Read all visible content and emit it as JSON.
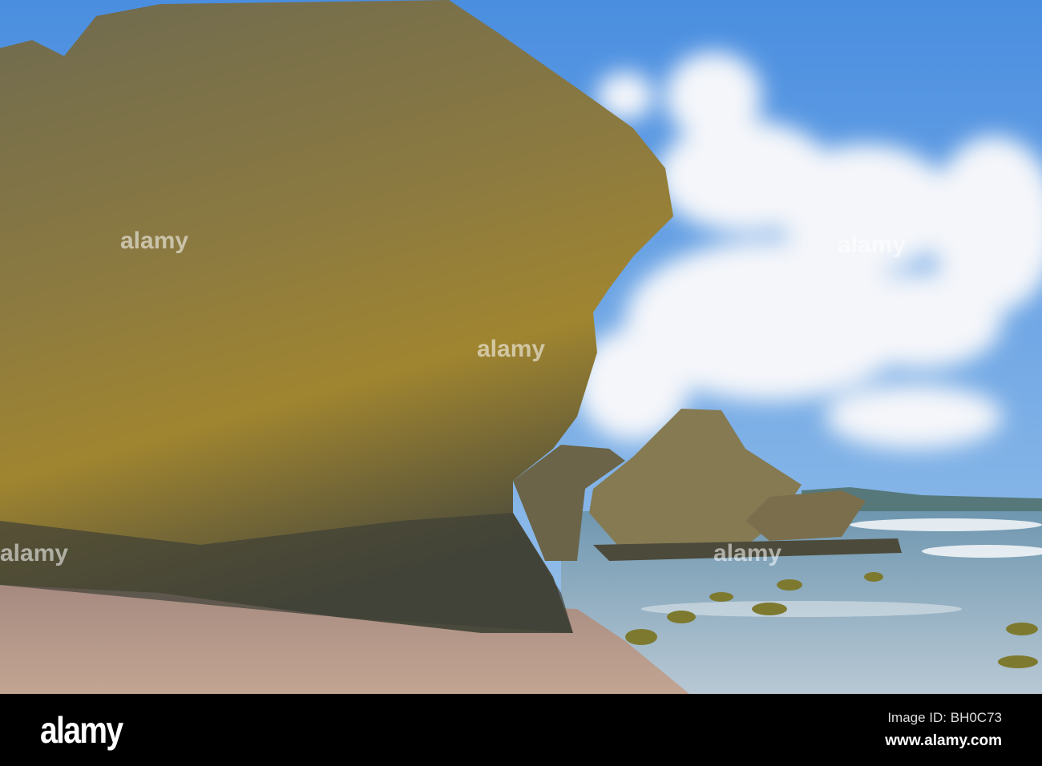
{
  "photo": {
    "subject": "coastal rock formations on beach",
    "colors": {
      "sky": "#5b9be0",
      "rock": "#8a7a3e",
      "sand": "#b89a8a",
      "sea": "#c8d8e4",
      "bar": "#000000"
    }
  },
  "watermark": {
    "text": "alamy"
  },
  "footer": {
    "logo": "alamy",
    "image_id": "Image ID: BH0C73",
    "url": "www.alamy.com"
  }
}
